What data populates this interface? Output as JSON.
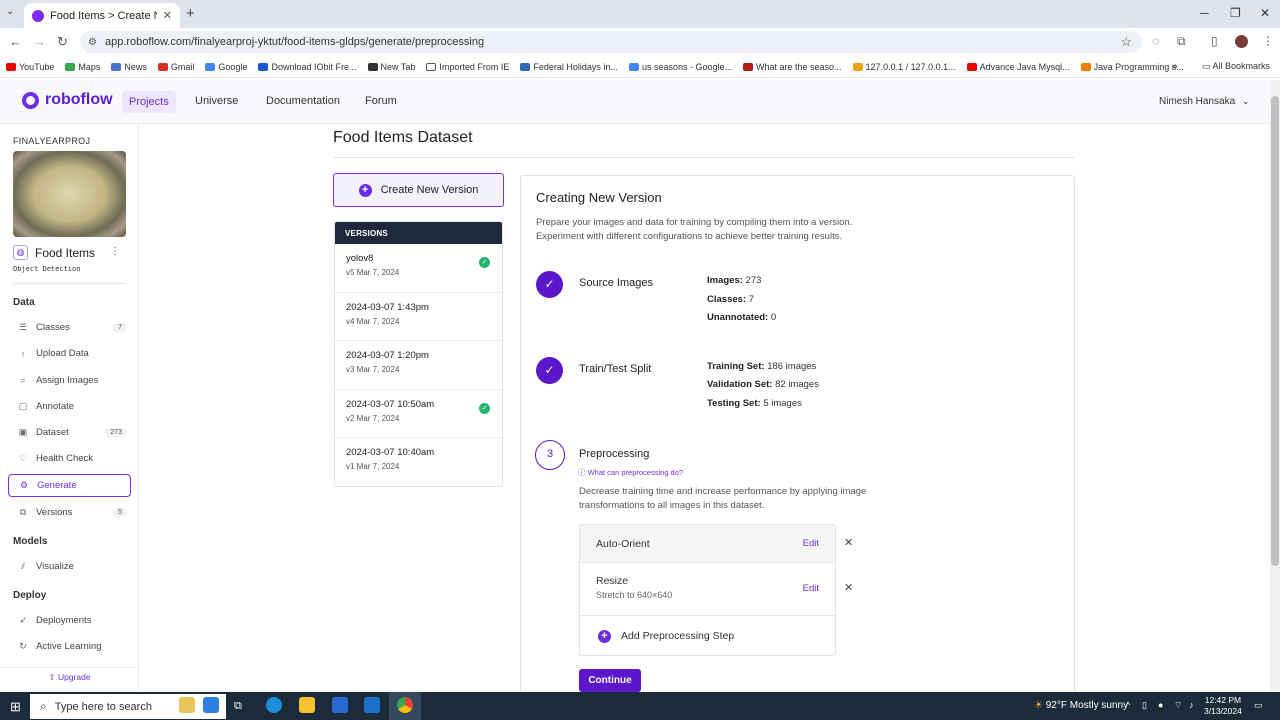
{
  "browser": {
    "tab_title": "Food Items > Create New Versi",
    "url": "app.roboflow.com/finalyearproj-yktut/food-items-gldps/generate/preprocessing",
    "bookmarks": [
      "YouTube",
      "Maps",
      "News",
      "Gmail",
      "Google",
      "Download IObit Fre...",
      "New Tab",
      "Imported From IE",
      "Federal Holidays in...",
      "us seasons - Google...",
      "What are the seaso...",
      "127.0.0.1 / 127.0.0.1...",
      "Advance Java Mysql...",
      "Java Programming s..."
    ],
    "all_bookmarks": "All Bookmarks"
  },
  "app": {
    "brand": "roboflow",
    "nav": [
      "Projects",
      "Universe",
      "Documentation",
      "Forum"
    ],
    "user": "Nimesh Hansaka"
  },
  "sidebar": {
    "workspace": "FINALYEARPROJ",
    "project_name": "Food Items",
    "project_type": "Object Detection",
    "sections": {
      "data": "Data",
      "models": "Models",
      "deploy": "Deploy"
    },
    "items": {
      "classes": {
        "label": "Classes",
        "count": "7"
      },
      "upload": {
        "label": "Upload Data"
      },
      "assign": {
        "label": "Assign Images"
      },
      "annotate": {
        "label": "Annotate"
      },
      "dataset": {
        "label": "Dataset",
        "count": "273"
      },
      "health": {
        "label": "Health Check"
      },
      "generate": {
        "label": "Generate"
      },
      "versions": {
        "label": "Versions",
        "count": "5"
      },
      "visualize": {
        "label": "Visualize"
      },
      "deployments": {
        "label": "Deployments"
      },
      "active": {
        "label": "Active Learning"
      }
    },
    "upgrade": "Upgrade"
  },
  "main": {
    "dataset_title": "Food Items Dataset",
    "create_button": "Create New Version",
    "versions_header": "VERSIONS",
    "versions": [
      {
        "name": "yolov8",
        "sub": "v5 Mar 7, 2024",
        "check": true
      },
      {
        "name": "2024-03-07 1:43pm",
        "sub": "v4 Mar 7, 2024",
        "check": false
      },
      {
        "name": "2024-03-07 1:20pm",
        "sub": "v3 Mar 7, 2024",
        "check": false
      },
      {
        "name": "2024-03-07 10:50am",
        "sub": "v2 Mar 7, 2024",
        "check": true
      },
      {
        "name": "2024-03-07 10:40am",
        "sub": "v1 Mar 7, 2024",
        "check": false
      }
    ]
  },
  "panel": {
    "title": "Creating New Version",
    "description": "Prepare your images and data for training by compiling them into a version. Experiment with different configurations to achieve better training results.",
    "source": {
      "title": "Source Images",
      "images_label": "Images:",
      "images": "273",
      "classes_label": "Classes:",
      "classes": "7",
      "unannotated_label": "Unannotated:",
      "unannotated": "0"
    },
    "split": {
      "title": "Train/Test Split",
      "train_label": "Training Set:",
      "train": "186 images",
      "valid_label": "Validation Set:",
      "valid": "82 images",
      "test_label": "Testing Set:",
      "test": "5 images"
    },
    "preprocessing": {
      "number": "3",
      "title": "Preprocessing",
      "help": "What can preprocessing do?",
      "description": "Decrease training time and increase performance by applying image transformations to all images in this dataset.",
      "steps": [
        {
          "name": "Auto-Orient",
          "detail": ""
        },
        {
          "name": "Resize",
          "detail": "Stretch to 640×640"
        }
      ],
      "edit_label": "Edit",
      "add_label": "Add Preprocessing Step",
      "continue_label": "Continue"
    }
  },
  "taskbar": {
    "search_placeholder": "Type here to search",
    "weather": "92°F  Mostly sunny",
    "time": "12:42 PM",
    "date": "3/13/2024"
  }
}
